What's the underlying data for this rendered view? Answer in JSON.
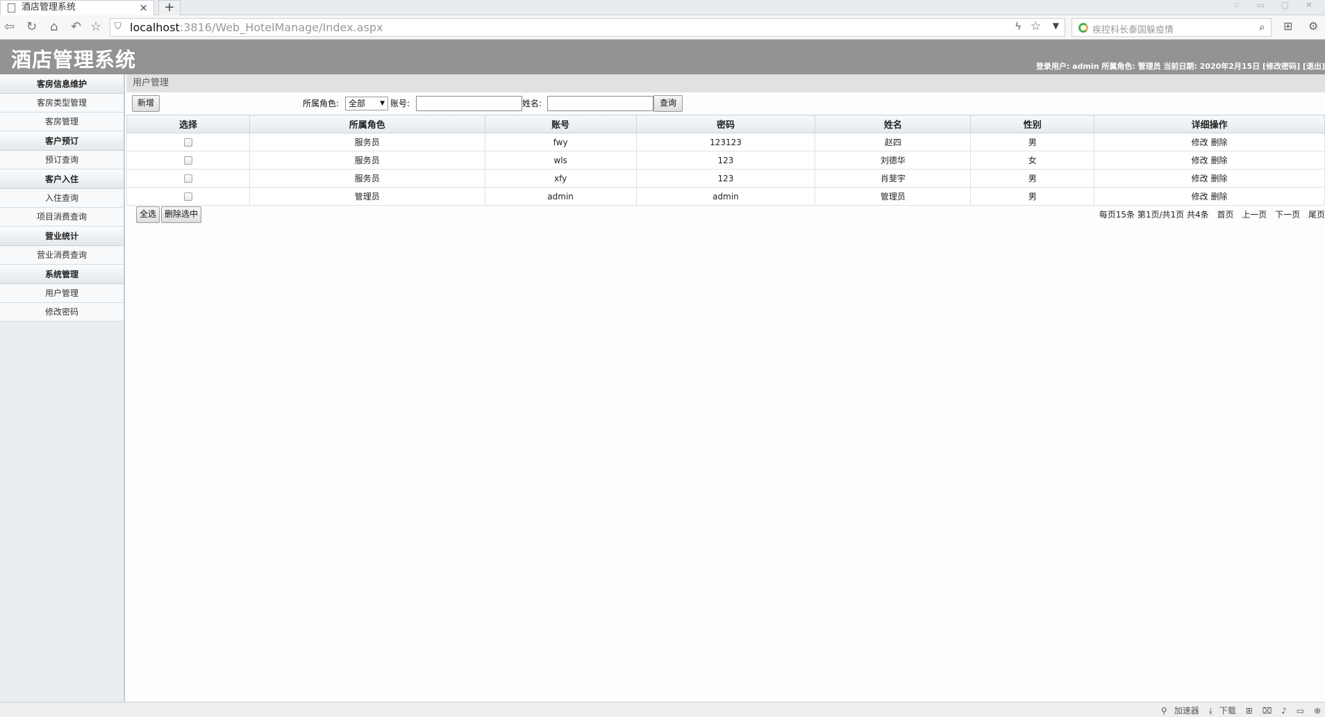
{
  "browser": {
    "tab_title": "酒店管理系统",
    "tab_close": "×",
    "new_tab": "+",
    "url_host": "localhost",
    "url_rest": ":3816/Web_HotelManage/Index.aspx",
    "search_placeholder": "疾控科长泰国躲疫情",
    "status_items": [
      "加速器",
      "下载"
    ]
  },
  "app": {
    "title": "酒店管理系统",
    "user_info": "登录用户: admin 所属角色: 管理员 当前日期: 2020年2月15日 [修改密码] [退出]"
  },
  "sidebar": {
    "groups": [
      {
        "title": "客房信息维护",
        "items": [
          "客房类型管理",
          "客房管理"
        ]
      },
      {
        "title": "客户预订",
        "items": [
          "预订查询"
        ]
      },
      {
        "title": "客户入住",
        "items": [
          "入住查询",
          "项目消费查询"
        ]
      },
      {
        "title": "营业统计",
        "items": [
          "营业消费查询"
        ]
      },
      {
        "title": "系统管理",
        "items": [
          "用户管理",
          "修改密码"
        ]
      }
    ]
  },
  "main": {
    "breadcrumb": "用户管理",
    "toolbar": {
      "add_label": "新增",
      "role_label": "所属角色:",
      "role_value": "全部",
      "account_label": "账号:",
      "name_label": "姓名:",
      "query_label": "查询"
    },
    "table": {
      "headers": [
        "选择",
        "所属角色",
        "账号",
        "密码",
        "姓名",
        "性别",
        "详细操作"
      ],
      "rows": [
        {
          "role": "服务员",
          "account": "fwy",
          "password": "123123",
          "name": "赵四",
          "gender": "男"
        },
        {
          "role": "服务员",
          "account": "wls",
          "password": "123",
          "name": "刘德华",
          "gender": "女"
        },
        {
          "role": "服务员",
          "account": "xfy",
          "password": "123",
          "name": "肖斐宇",
          "gender": "男"
        },
        {
          "role": "管理员",
          "account": "admin",
          "password": "admin",
          "name": "管理员",
          "gender": "男"
        }
      ],
      "edit_label": "修改",
      "delete_label": "删除"
    },
    "select_all_label": "全选",
    "delete_selected_label": "删除选中",
    "pager": {
      "info": "每页15条 第1页/共1页 共4条",
      "first": "首页",
      "prev": "上一页",
      "next": "下一页",
      "last": "尾页"
    }
  }
}
